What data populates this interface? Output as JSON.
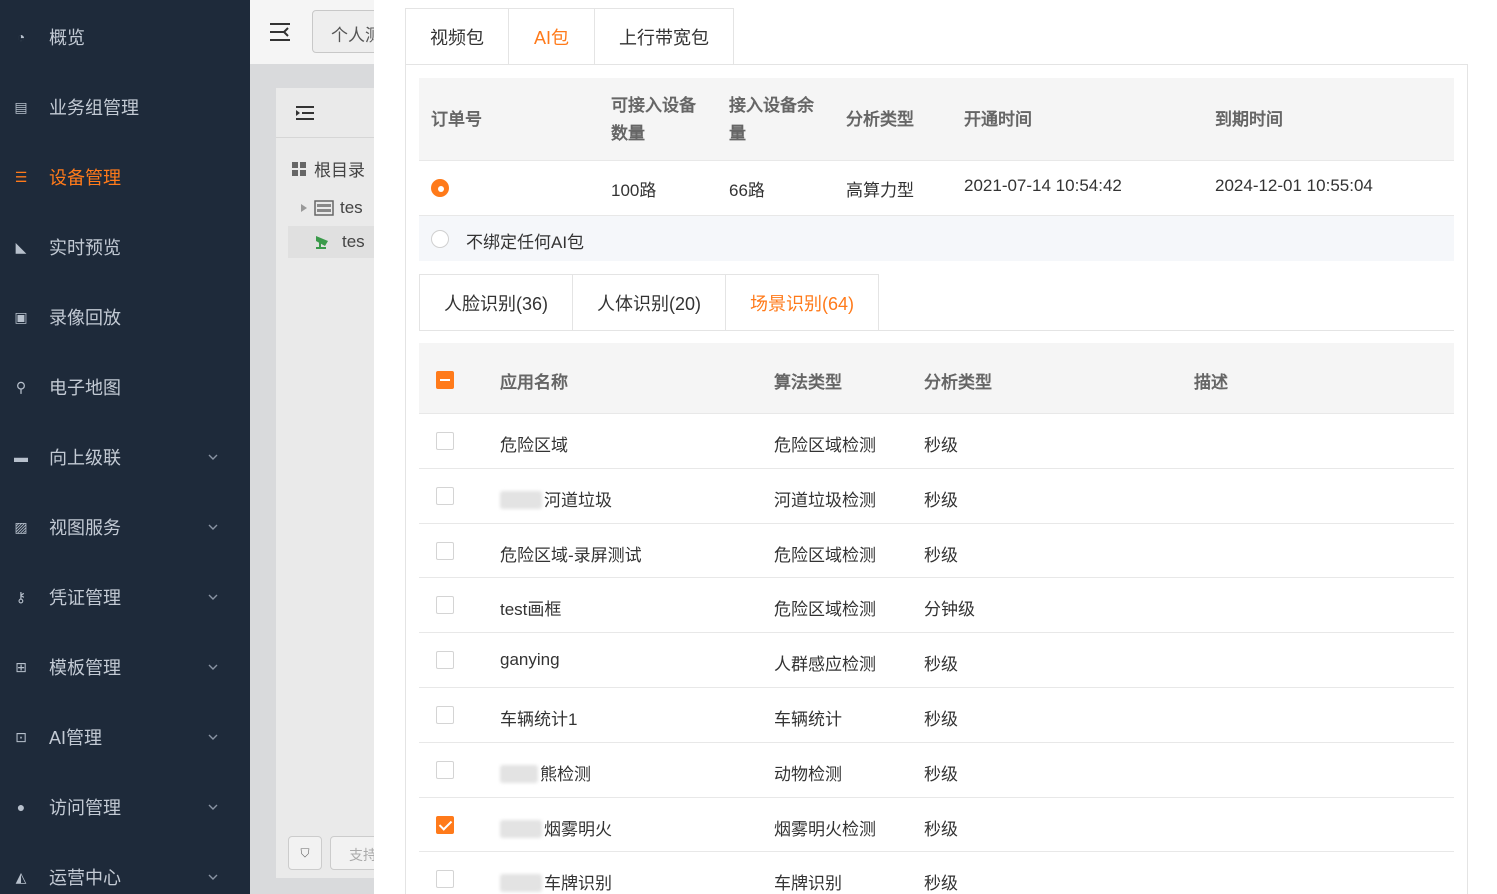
{
  "sidebar": {
    "items": [
      {
        "label": "概览",
        "icon": "dashboard-icon",
        "active": false,
        "expandable": false
      },
      {
        "label": "业务组管理",
        "icon": "sitemap-icon",
        "active": false,
        "expandable": false
      },
      {
        "label": "设备管理",
        "icon": "device-icon",
        "active": true,
        "expandable": false
      },
      {
        "label": "实时预览",
        "icon": "camera-icon",
        "active": false,
        "expandable": false
      },
      {
        "label": "录像回放",
        "icon": "video-icon",
        "active": false,
        "expandable": false
      },
      {
        "label": "电子地图",
        "icon": "map-marker-icon",
        "active": false,
        "expandable": false
      },
      {
        "label": "向上级联",
        "icon": "server-icon",
        "active": false,
        "expandable": true
      },
      {
        "label": "视图服务",
        "icon": "picture-icon",
        "active": false,
        "expandable": true
      },
      {
        "label": "凭证管理",
        "icon": "key-icon",
        "active": false,
        "expandable": true
      },
      {
        "label": "模板管理",
        "icon": "template-icon",
        "active": false,
        "expandable": true
      },
      {
        "label": "AI管理",
        "icon": "ai-scan-icon",
        "active": false,
        "expandable": true
      },
      {
        "label": "访问管理",
        "icon": "user-icon",
        "active": false,
        "expandable": true
      },
      {
        "label": "运营中心",
        "icon": "bell-icon",
        "active": false,
        "expandable": true
      }
    ]
  },
  "background": {
    "tab_chip": "个人测",
    "tree_root": "根目录",
    "tree_items": [
      "tes",
      "tes"
    ],
    "search_placeholder": "支持"
  },
  "top_tabs": [
    {
      "label": "视频包",
      "active": false
    },
    {
      "label": "AI包",
      "active": true
    },
    {
      "label": "上行带宽包",
      "active": false
    }
  ],
  "orders": {
    "headers": [
      "订单号",
      "可接入设备数量",
      "接入设备余量",
      "分析类型",
      "开通时间",
      "到期时间"
    ],
    "rows": [
      {
        "selected": true,
        "order_no": "",
        "capacity": "100路",
        "remaining": "66路",
        "analysis": "高算力型",
        "start": "2021-07-14 10:54:42",
        "end": "2024-12-01 10:55:04"
      }
    ],
    "none_label": "不绑定任何AI包"
  },
  "sub_tabs": [
    {
      "label": "人脸识别(36)",
      "active": false
    },
    {
      "label": "人体识别(20)",
      "active": false
    },
    {
      "label": "场景识别(64)",
      "active": true
    }
  ],
  "apps": {
    "headers": [
      "应用名称",
      "算法类型",
      "分析类型",
      "描述"
    ],
    "select_all_state": "indeterminate",
    "rows": [
      {
        "checked": false,
        "name": "危险区域",
        "redacted": false,
        "algo": "危险区域检测",
        "analysis": "秒级",
        "desc": ""
      },
      {
        "checked": false,
        "name": "河道垃圾",
        "redacted": true,
        "algo": "河道垃圾检测",
        "analysis": "秒级",
        "desc": ""
      },
      {
        "checked": false,
        "name": "危险区域-录屏测试",
        "redacted": false,
        "algo": "危险区域检测",
        "analysis": "秒级",
        "desc": ""
      },
      {
        "checked": false,
        "name": "test画框",
        "redacted": false,
        "algo": "危险区域检测",
        "analysis": "分钟级",
        "desc": ""
      },
      {
        "checked": false,
        "name": "ganying",
        "redacted": false,
        "algo": "人群感应检测",
        "analysis": "秒级",
        "desc": ""
      },
      {
        "checked": false,
        "name": "车辆统计1",
        "redacted": false,
        "algo": "车辆统计",
        "analysis": "秒级",
        "desc": ""
      },
      {
        "checked": false,
        "name": "熊检测",
        "redacted": true,
        "algo": "动物检测",
        "analysis": "秒级",
        "desc": ""
      },
      {
        "checked": true,
        "name": "烟雾明火",
        "redacted": true,
        "algo": "烟雾明火检测",
        "analysis": "秒级",
        "desc": ""
      },
      {
        "checked": false,
        "name": "车牌识别",
        "redacted": true,
        "algo": "车牌识别",
        "analysis": "秒级",
        "desc": ""
      }
    ]
  },
  "colors": {
    "accent": "#ff7a1a",
    "sidebar_bg": "#1e2a3a"
  }
}
